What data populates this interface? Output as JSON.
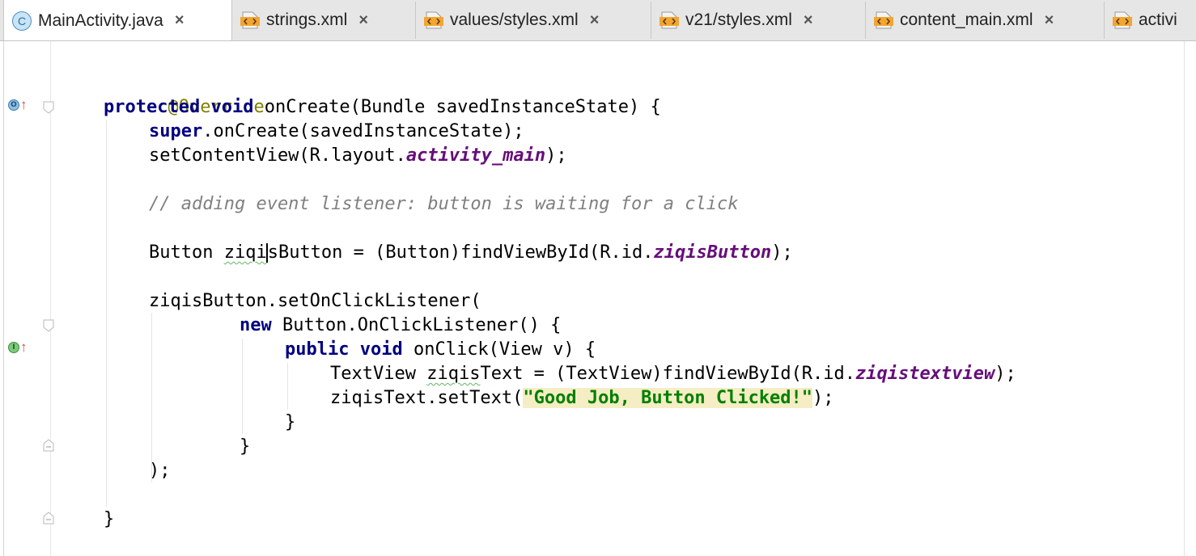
{
  "tabs": [
    {
      "label": "MainActivity.java",
      "icon": "java-class-icon",
      "active": true
    },
    {
      "label": "strings.xml",
      "icon": "xml-file-icon"
    },
    {
      "label": "values/styles.xml",
      "icon": "xml-file-icon"
    },
    {
      "label": "v21/styles.xml",
      "icon": "xml-file-icon"
    },
    {
      "label": "content_main.xml",
      "icon": "xml-file-icon"
    },
    {
      "label": "activi",
      "icon": "xml-file-icon"
    }
  ],
  "tab_close_glyph": "×",
  "class_icon_letter": "C",
  "gutter": {
    "override_marker": "O",
    "implements_marker": "I",
    "marker_arrow": "↑"
  },
  "code": {
    "l1": {
      "annotation": "@Override"
    },
    "l2": {
      "kw1": "protected",
      "kw2": "void",
      "rest": " onCreate(Bundle savedInstanceState) {"
    },
    "l3": {
      "kw": "super",
      "rest": ".onCreate(savedInstanceState);"
    },
    "l4": {
      "pre": "setContentView(R.layout.",
      "field": "activity_main",
      "post": ");"
    },
    "l5": {
      "comment": "// adding event listener: button is waiting for a click"
    },
    "l6": {
      "pre": "Button ",
      "var_a": "ziqi",
      "var_b": "sButton",
      "mid": " = (Button)findViewById(R.id.",
      "field": "ziqisButton",
      "post": ");"
    },
    "l7": {
      "text": "ziqisButton.setOnClickListener("
    },
    "l8": {
      "kw": "new",
      "rest": " Button.OnClickListener() {"
    },
    "l9": {
      "kw1": "public",
      "kw2": "void",
      "rest": " onClick(View v) {"
    },
    "l10": {
      "pre": "TextView ",
      "var": "ziqis",
      "var_b": "Text",
      "mid": " = (TextView)findViewById(R.id.",
      "field": "ziqistextview",
      "post": ");"
    },
    "l11": {
      "pre": "ziqisText.setText(",
      "string": "\"Good Job, Button Clicked!\"",
      "post": ");"
    },
    "l12": {
      "text": "}"
    },
    "l13": {
      "text": "}"
    },
    "l14": {
      "text": ");"
    },
    "l15": {
      "text": "}"
    }
  },
  "colors": {
    "keyword": "#000080",
    "annotation": "#808000",
    "field": "#660e7a",
    "comment": "#808080",
    "string": "#008000",
    "string_highlight": "#f5edc4"
  }
}
